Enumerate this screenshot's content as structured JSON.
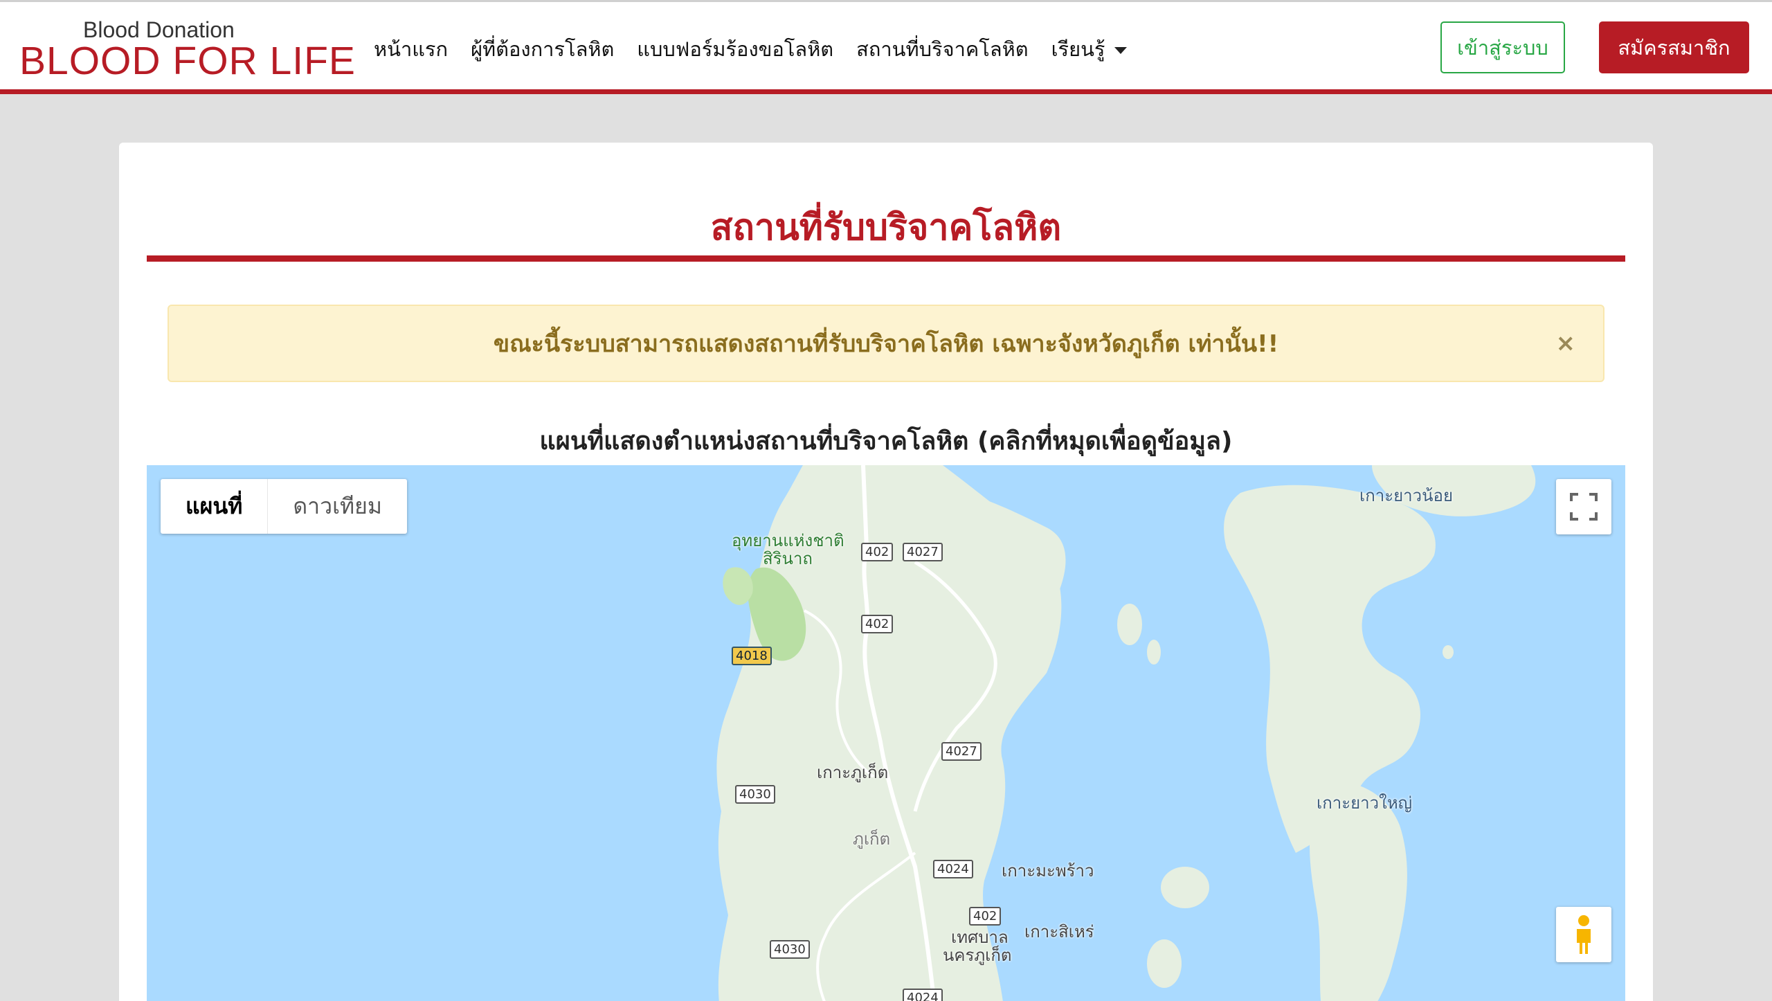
{
  "brand": {
    "small": "Blood Donation",
    "big": "BLOOD FOR LIFE"
  },
  "nav": {
    "items": [
      {
        "label": "หน้าแรก"
      },
      {
        "label": "ผู้ที่ต้องการโลหิต"
      },
      {
        "label": "แบบฟอร์มร้องขอโลหิต"
      },
      {
        "label": "สถานที่บริจาคโลหิต"
      },
      {
        "label": "เรียนรู้",
        "dropdown": true
      }
    ],
    "login_label": "เข้าสู่ระบบ",
    "register_label": "สมัครสมาชิก"
  },
  "page": {
    "title": "สถานที่รับบริจาคโลหิต",
    "alert": "ขณะนี้ระบบสามารถแสดงสถานที่รับบริจาคโลหิต เฉพาะจังหวัดภูเก็ต เท่านั้น!!",
    "alert_close": "×",
    "map_caption": "แผนที่แสดงตำแหน่งสถานที่บริจาคโลหิต (คลิกที่หมุดเพื่อดูข้อมูล)"
  },
  "map": {
    "type_map": "แผนที่",
    "type_satellite": "ดาวเทียม",
    "labels": {
      "koh_yao_noi": "เกาะยาวน้อย",
      "park_line1": "อุทยานแห่งชาติ",
      "park_line2": "สิรินาถ",
      "koh_phuket": "เกาะภูเก็ต",
      "phuket": "ภูเก็ต",
      "koh_yao_yai": "เกาะยาวใหญ่",
      "koh_maphrao": "เกาะมะพร้าว",
      "koh_sire": "เกาะสิเหร่",
      "municipality_line1": "เทศบาล",
      "municipality_line2": "นครภูเก็ต"
    },
    "roads": {
      "r402a": "402",
      "r4027a": "4027",
      "r402b": "402",
      "r4018": "4018",
      "r4027b": "4027",
      "r4030a": "4030",
      "r4024a": "4024",
      "r402c": "402",
      "r4030b": "4030",
      "r4024b": "4024"
    },
    "colors": {
      "water": "#aadaff",
      "land": "#e6efe1",
      "park": "#b9dfa4",
      "road": "#ffffff"
    }
  },
  "colors": {
    "brand_red": "#b71c25",
    "login_green": "#28a745",
    "alert_bg": "#fdf3d1",
    "alert_text": "#8a6d1e"
  }
}
